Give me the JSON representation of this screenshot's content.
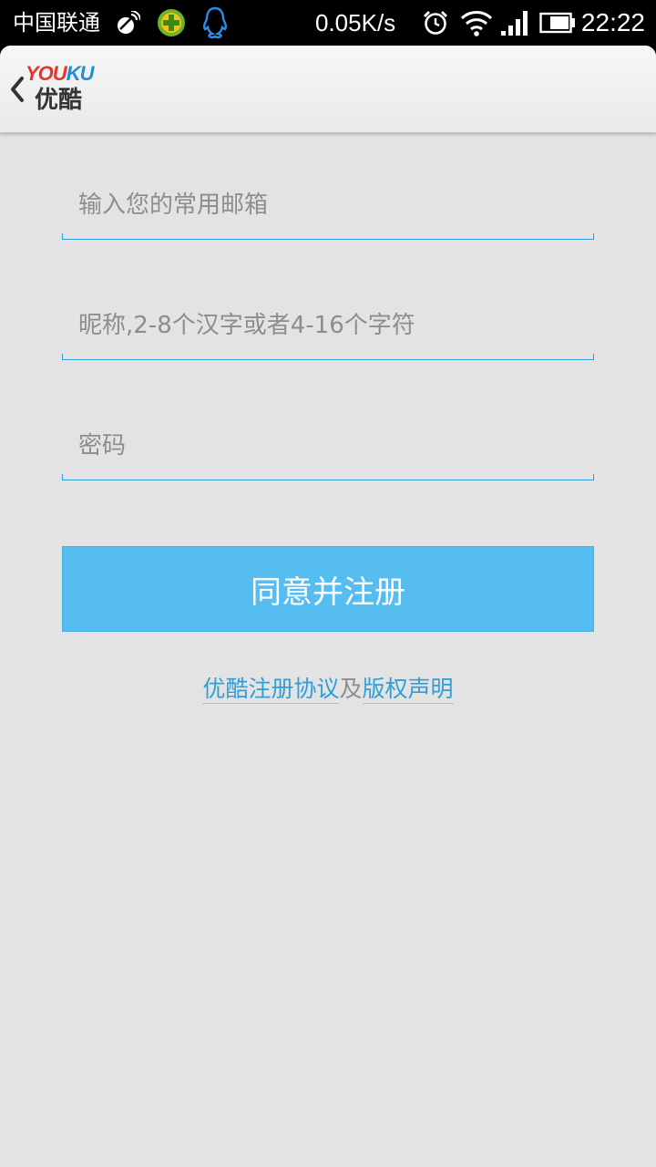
{
  "status_bar": {
    "carrier": "中国联通",
    "network_speed": "0.05K/s",
    "time": "22:22",
    "icons": [
      "satellite-dish-icon",
      "360-security-icon",
      "qq-penguin-icon",
      "alarm-clock-icon",
      "wifi-icon",
      "signal-strength-icon",
      "battery-icon"
    ]
  },
  "header": {
    "logo_latin_red": "YOU",
    "logo_latin_blue": "KU",
    "logo_name": "优酷",
    "back_icon": "chevron-left-icon"
  },
  "form": {
    "email_placeholder": "输入您的常用邮箱",
    "nickname_placeholder": "昵称,2-8个汉字或者4-16个字符",
    "password_placeholder": "密码",
    "submit_label": "同意并注册"
  },
  "links": {
    "agreement_label": "优酷注册协议",
    "separator": "及",
    "copyright_label": "版权声明"
  },
  "colors": {
    "accent": "#55bdf0",
    "link": "#2f9fd8",
    "logo_red": "#e8352b",
    "logo_blue": "#1e8fd6",
    "background": "#e3e3e3"
  }
}
